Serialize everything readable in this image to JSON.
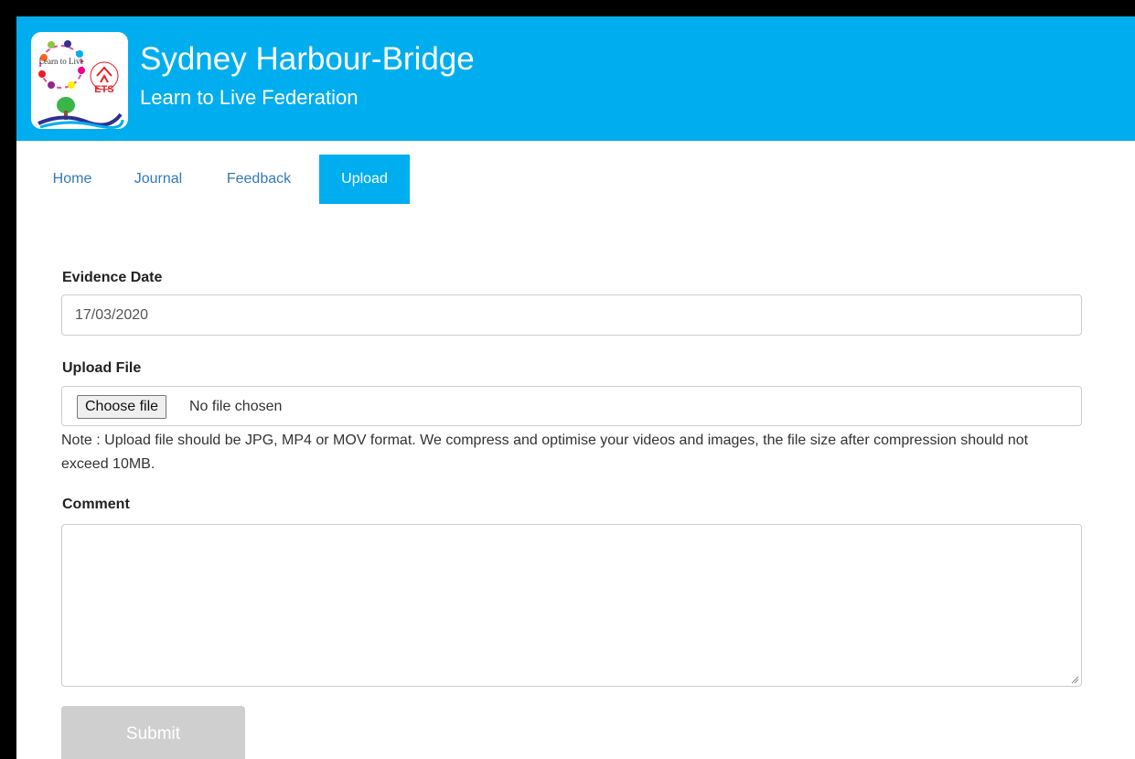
{
  "header": {
    "title": "Sydney Harbour-Bridge",
    "subtitle": "Learn to Live Federation",
    "logo_text": "Learn to Live",
    "logo_badge": "ETS",
    "brand_color": "#00aeef"
  },
  "nav": {
    "items": [
      {
        "label": "Home",
        "active": false
      },
      {
        "label": "Journal",
        "active": false
      },
      {
        "label": "Feedback",
        "active": false
      },
      {
        "label": "Upload",
        "active": true
      }
    ]
  },
  "form": {
    "evidence_date": {
      "label": "Evidence Date",
      "value": "17/03/2020"
    },
    "upload_file": {
      "label": "Upload File",
      "button_label": "Choose file",
      "status": "No file chosen",
      "note": "Note : Upload file should be JPG, MP4 or MOV format. We compress and optimise your videos and images, the file size after compression should not exceed 10MB."
    },
    "comment": {
      "label": "Comment",
      "value": ""
    },
    "submit_label": "Submit"
  }
}
